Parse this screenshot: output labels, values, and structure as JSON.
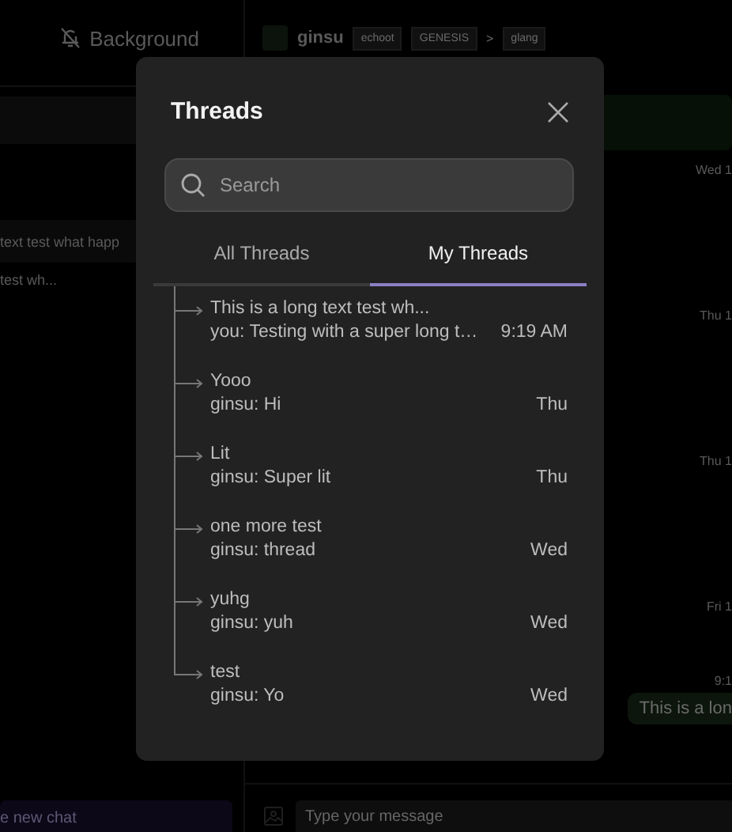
{
  "background": {
    "sidebar": {
      "header": "Background",
      "chats": [
        "text test what happ",
        "test wh..."
      ],
      "new_chat": "e new chat"
    },
    "chat": {
      "user": "ginsu",
      "chips": [
        "echoot",
        "GENESIS",
        "glang"
      ],
      "separator": ">",
      "times": [
        "Wed 1",
        "Thu 1",
        "Thu 1",
        "Fri 1",
        "9:1"
      ],
      "bubble": "This is a lon",
      "composer": {
        "placeholder": "Type your message"
      }
    }
  },
  "dialog": {
    "title": "Threads",
    "search": {
      "placeholder": "Search"
    },
    "tabs": [
      {
        "label": "All Threads",
        "selected": false
      },
      {
        "label": "My Threads",
        "selected": true
      }
    ],
    "threads": [
      {
        "title": "This is a long text test wh...",
        "preview": "you: Testing with a super long t…",
        "time": "9:19 AM"
      },
      {
        "title": "Yooo",
        "preview": "ginsu: Hi",
        "time": "Thu"
      },
      {
        "title": "Lit",
        "preview": "ginsu: Super lit",
        "time": "Thu"
      },
      {
        "title": "one more test",
        "preview": "ginsu: thread",
        "time": "Wed"
      },
      {
        "title": "yuhg",
        "preview": "ginsu: yuh",
        "time": "Wed"
      },
      {
        "title": "test",
        "preview": "ginsu: Yo",
        "time": "Wed"
      }
    ]
  }
}
